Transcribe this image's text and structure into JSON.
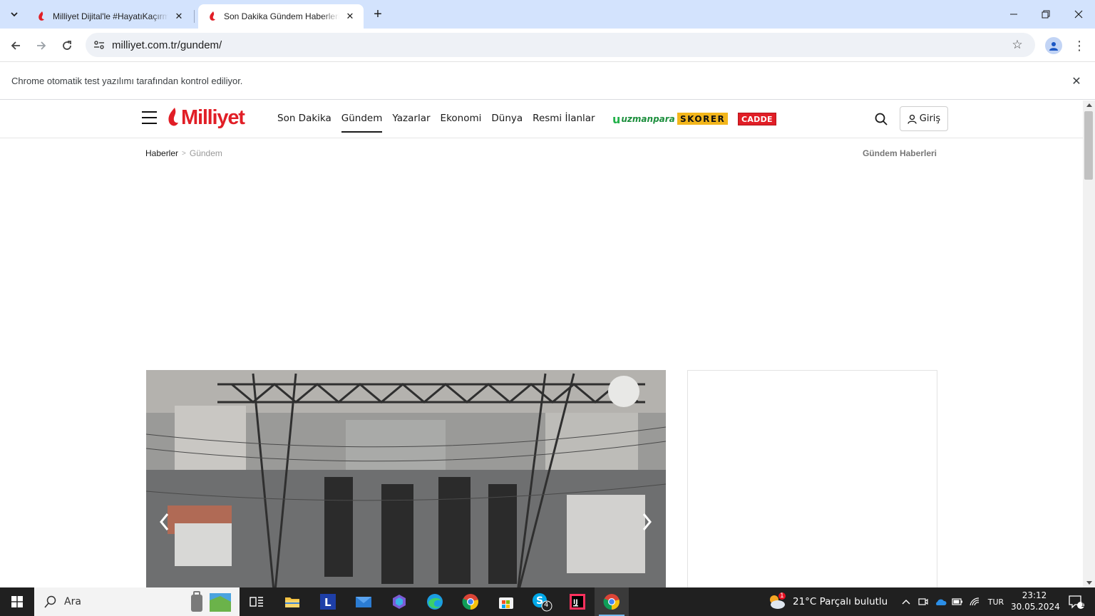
{
  "browser": {
    "tabs": [
      {
        "title": "Milliyet Dijital'le #HayatıKaçırma",
        "active": false
      },
      {
        "title": "Son Dakika Gündem Haberleri - M",
        "active": true
      }
    ],
    "url": "milliyet.com.tr/gundem/",
    "infobar": "Chrome otomatik test yazılımı tarafından kontrol ediliyor."
  },
  "site": {
    "logo": "Milliyet",
    "brand_color": "#e11e26",
    "nav": [
      {
        "label": "Son Dakika"
      },
      {
        "label": "Gündem",
        "active": true
      },
      {
        "label": "Yazarlar"
      },
      {
        "label": "Ekonomi"
      },
      {
        "label": "Dünya"
      },
      {
        "label": "Resmi İlanlar"
      }
    ],
    "partners": {
      "uzmanpara": "uzmanpara",
      "skorer": "SKORER",
      "cadde": "CADDE"
    },
    "login_label": "Giriş",
    "breadcrumb": {
      "home": "Haberler",
      "current": "Gündem"
    },
    "section_title": "Gündem Haberleri",
    "hero": {
      "image": "electrical-substation-fire-photo"
    }
  },
  "taskbar": {
    "search_placeholder": "Ara",
    "weather": "21°C  Parçalı bulutlu",
    "language": "TUR",
    "time": "23:12",
    "date": "30.05.2024",
    "skype_badge": "4",
    "notification_badge": "1",
    "weather_badge": "1"
  }
}
